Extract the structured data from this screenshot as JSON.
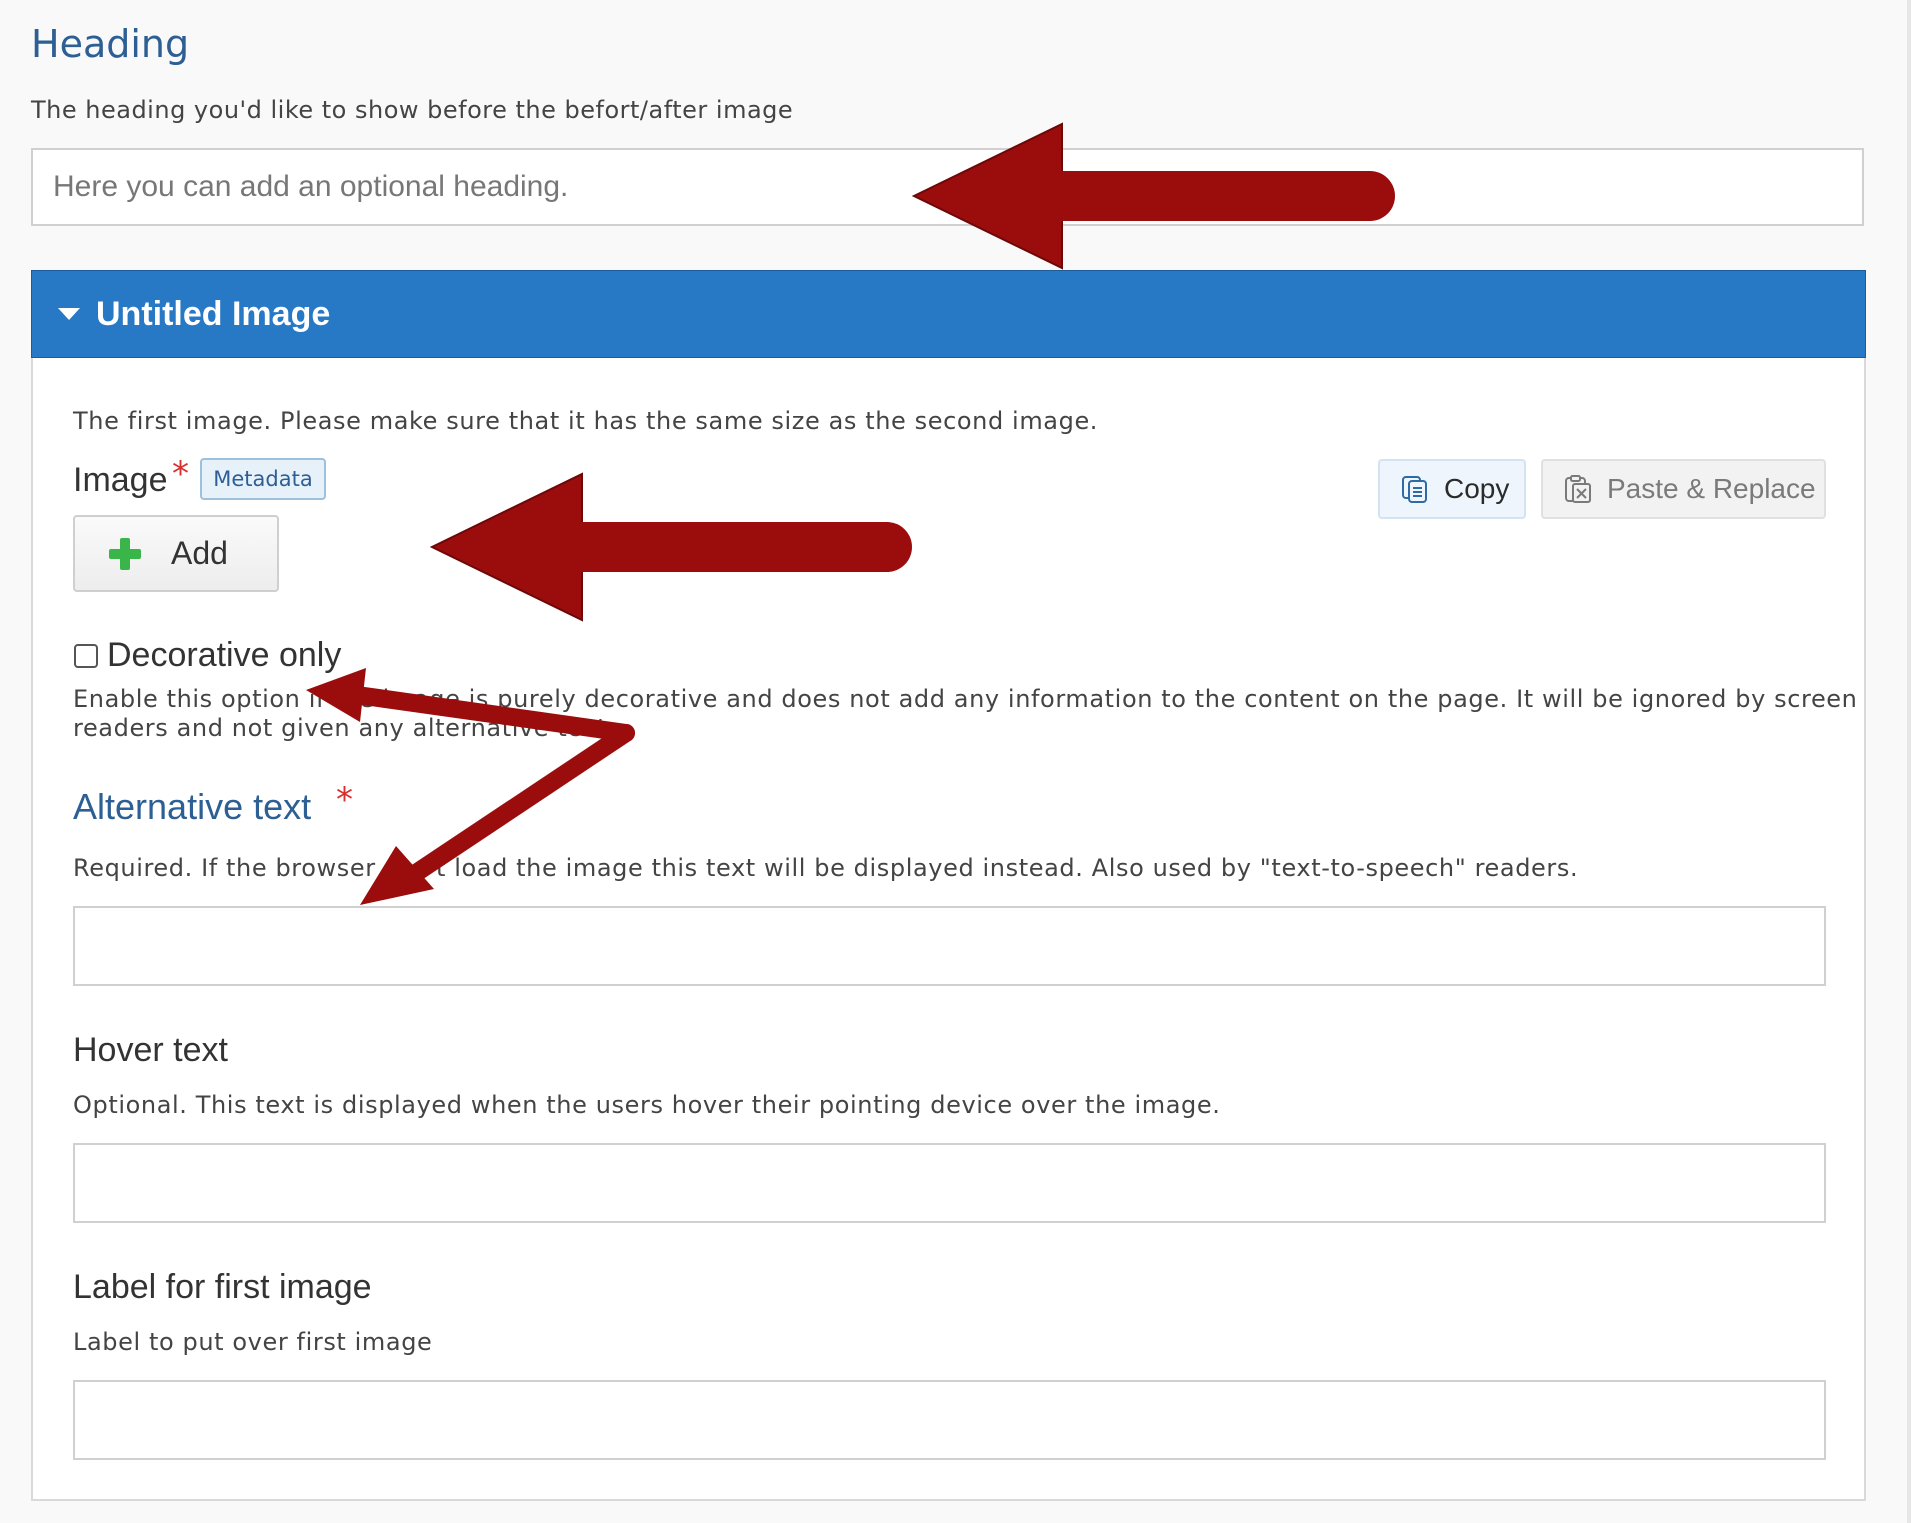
{
  "heading": {
    "title": "Heading",
    "description": "The heading you'd like to show before the befort/after image",
    "placeholder": "Here you can add an optional heading."
  },
  "group": {
    "title": "Untitled Image",
    "description": "The first image. Please make sure that it has the same size as the second image."
  },
  "image_field": {
    "label": "Image",
    "required_mark": "*",
    "metadata_label": "Metadata",
    "add_label": "Add"
  },
  "toolbar": {
    "copy_label": "Copy",
    "paste_label": "Paste & Replace"
  },
  "decorative": {
    "label": "Decorative only",
    "checked": false,
    "description_line1": "Enable this option if the image is purely decorative and does not add any information to the content on the page. It will be ignored by screen",
    "description_line2": "readers and not given any alternative text."
  },
  "alt_text": {
    "label": "Alternative text",
    "required_mark": "*",
    "description": "Required. If the browser can't load the image this text will be displayed instead. Also used by \"text-to-speech\" readers."
  },
  "hover_text": {
    "label": "Hover text",
    "description": "Optional. This text is displayed when the users hover their pointing device over the image."
  },
  "first_label": {
    "label": "Label for first image",
    "description": "Label to put over first image"
  },
  "colors": {
    "accent_blue": "#2779c6",
    "heading_blue": "#2d5f94",
    "annotation_arrow": "#9b0d0d",
    "add_icon_green": "#39b54a",
    "required_red": "#d9302d"
  }
}
